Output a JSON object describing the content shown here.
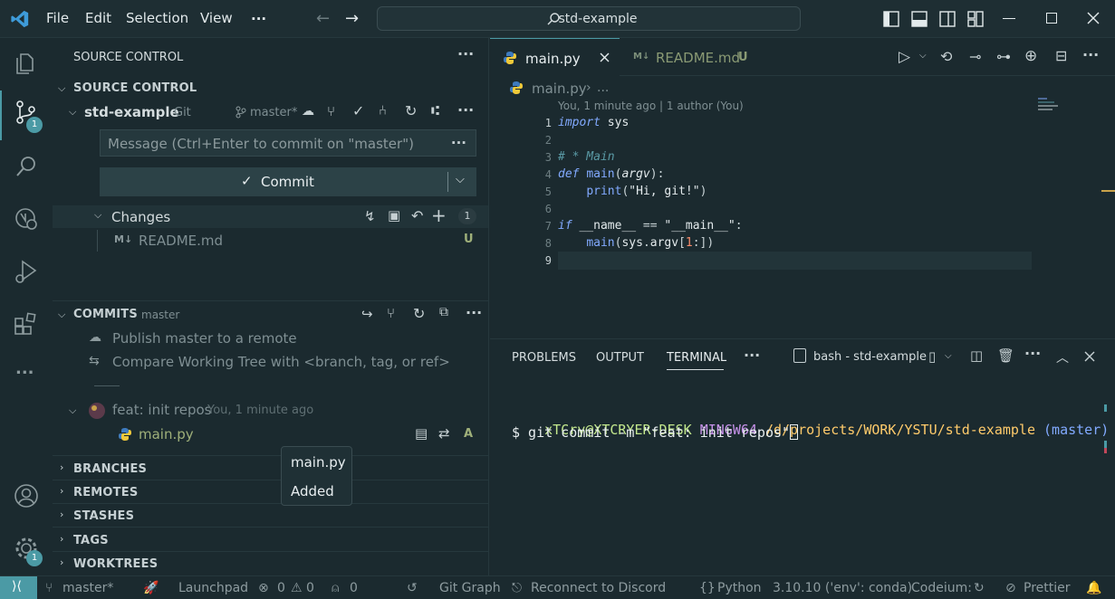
{
  "titlebar": {
    "menu": [
      "File",
      "Edit",
      "Selection",
      "View"
    ],
    "more": "...",
    "search": "std-example"
  },
  "activity": {
    "scm_badge": "1",
    "settings_badge": "1",
    "more": "..."
  },
  "sidebar": {
    "title": "SOURCE CONTROL",
    "section_title": "SOURCE CONTROL",
    "repo": {
      "name": "std-example",
      "provider": "Git",
      "branch": "master*"
    },
    "commit_placeholder": "Message (Ctrl+Enter to commit on \"master\")",
    "commit_button": "Commit",
    "changes": {
      "label": "Changes",
      "count": "1",
      "files": [
        {
          "name": "README.md",
          "status": "U",
          "icon": "M↓"
        }
      ]
    },
    "commits": {
      "title": "COMMITS",
      "branch": "master",
      "actions": [
        "Publish master to a remote",
        "Compare Working Tree with <branch, tag, or ref>"
      ],
      "commit": {
        "message": "feat: init repos",
        "meta": "You, 1 minute ago",
        "file": "main.py",
        "file_status": "A"
      }
    },
    "collapsed_sections": [
      "BRANCHES",
      "REMOTES",
      "STASHES",
      "TAGS",
      "WORKTREES"
    ]
  },
  "tooltip": {
    "file": "main.py",
    "status": "Added"
  },
  "editor": {
    "tabs": [
      {
        "label": "main.py",
        "active": true
      },
      {
        "label": "README.md",
        "badge": "U",
        "icon": "M↓"
      }
    ],
    "breadcrumb": [
      "main.py",
      "..."
    ],
    "blame": "You, 1 minute ago | 1 author (You)",
    "line_numbers": [
      "1",
      "2",
      "3",
      "4",
      "5",
      "6",
      "7",
      "8",
      "9"
    ]
  },
  "panel": {
    "tabs": [
      "PROBLEMS",
      "OUTPUT",
      "TERMINAL"
    ],
    "active_tab": "TERMINAL",
    "terminal_name": "bash - std-example",
    "prompt": {
      "user": "xTCry@XTCRYER-DESK",
      "shell": "MINGW64",
      "path": "/d/projects/WORK/YSTU/std-example",
      "branch": "(master)"
    },
    "command": "$ git commit -m \"feat: init repos\""
  },
  "statusbar": {
    "branch": "master*",
    "launchpad": "Launchpad",
    "errors": "0",
    "warnings": "0",
    "ports": "0",
    "git_graph": "Git Graph",
    "discord": "Reconnect to Discord",
    "language": "Python",
    "interpreter": "3.10.10 ('env': conda)",
    "codeium": "Codeium:",
    "prettier": "Prettier"
  },
  "colors": {
    "accent": "#4b9aa5",
    "background": "#1b2a2f",
    "untracked": "#9fb07a",
    "added": "#9fb07a"
  }
}
